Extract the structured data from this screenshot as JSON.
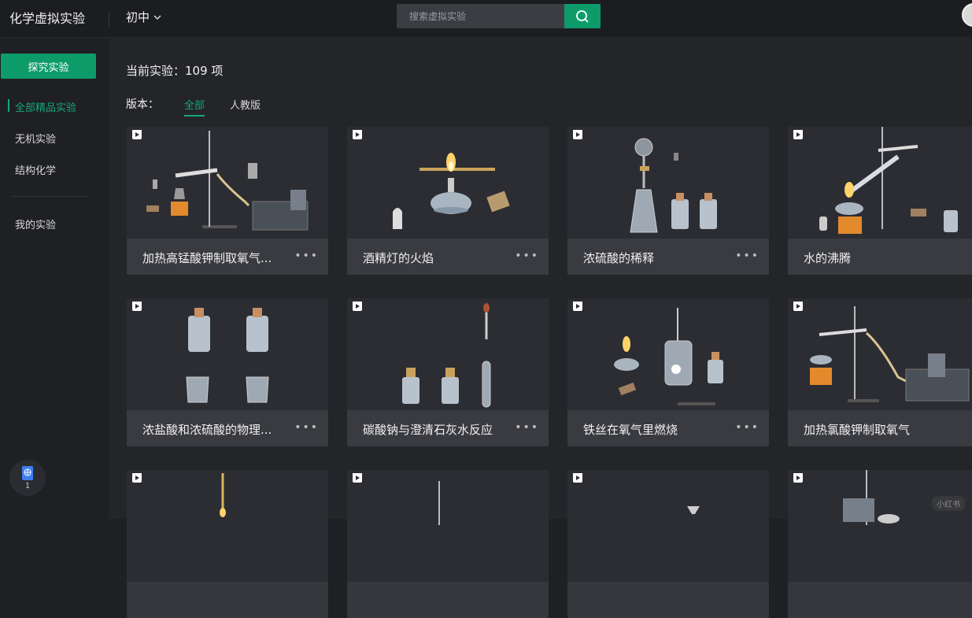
{
  "header": {
    "app_title": "化学虚拟实验",
    "grade": "初中",
    "search_placeholder": "搜索虚拟实验"
  },
  "sidebar": {
    "explore_button": "探究实验",
    "items": [
      {
        "label": "全部精品实验",
        "active": true
      },
      {
        "label": "无机实验",
        "active": false
      },
      {
        "label": "结构化学",
        "active": false
      },
      {
        "label": "我的实验",
        "active": false
      }
    ],
    "badge_count": "1"
  },
  "main": {
    "count_text": "当前实验：109 项",
    "edition_label": "版本：",
    "editions": [
      {
        "label": "全部",
        "active": true
      },
      {
        "label": "人教版",
        "active": false
      }
    ],
    "cards": [
      {
        "title": "加热高锰酸钾制取氧气...",
        "more": "•••"
      },
      {
        "title": "酒精灯的火焰",
        "more": "•••"
      },
      {
        "title": "浓硫酸的稀释",
        "more": "•••"
      },
      {
        "title": "水的沸腾",
        "more": "•••"
      },
      {
        "title": "浓盐酸和浓硫酸的物理...",
        "more": "•••"
      },
      {
        "title": "碳酸钠与澄清石灰水反应",
        "more": "•••"
      },
      {
        "title": "铁丝在氧气里燃烧",
        "more": "•••"
      },
      {
        "title": "加热氯酸钾制取氧气",
        "more": "•••"
      },
      {
        "title": "",
        "more": ""
      },
      {
        "title": "",
        "more": ""
      },
      {
        "title": "",
        "more": ""
      },
      {
        "title": "",
        "more": ""
      }
    ]
  },
  "watermark": "小红书",
  "colors": {
    "accent": "#0e9b6a",
    "accent_text": "#15a776",
    "background": "#242529",
    "card": "#36373c"
  }
}
